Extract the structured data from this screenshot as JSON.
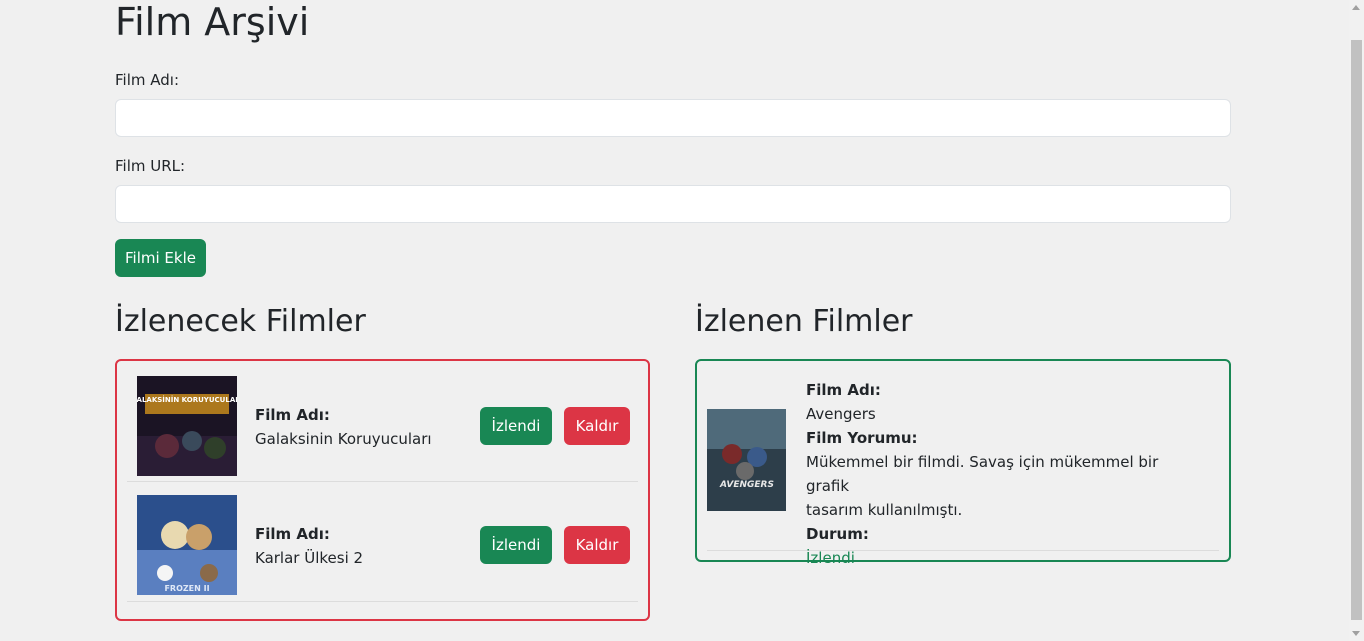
{
  "page": {
    "title": "Film Arşivi"
  },
  "form": {
    "name_label": "Film Adı:",
    "name_value": "",
    "url_label": "Film URL:",
    "url_value": "",
    "add_button": "Filmi Ekle"
  },
  "to_watch": {
    "heading": "İzlenecek Filmler",
    "items": [
      {
        "name_label": "Film Adı:",
        "name": "Galaksinin Koruyucuları",
        "watched_button": "İzlendi",
        "remove_button": "Kaldır",
        "poster_text": "GALAKSİNİN KORUYUCULARI"
      },
      {
        "name_label": "Film Adı:",
        "name": "Karlar Ülkesi 2",
        "watched_button": "İzlendi",
        "remove_button": "Kaldır",
        "poster_text": "FROZEN II"
      }
    ]
  },
  "watched": {
    "heading": "İzlenen Filmler",
    "items": [
      {
        "name_label": "Film Adı:",
        "name": "Avengers",
        "review_label": "Film Yorumu:",
        "review_line1": "Mükemmel bir filmdi. Savaş için mükemmel bir grafik",
        "review_line2": "tasarım kullanılmıştı.",
        "status_label": "Durum:",
        "status": "İzlendi",
        "poster_text": "AVENGERS"
      }
    ]
  },
  "colors": {
    "green": "#198754",
    "red": "#dc3545",
    "background": "#f0f0f0"
  }
}
